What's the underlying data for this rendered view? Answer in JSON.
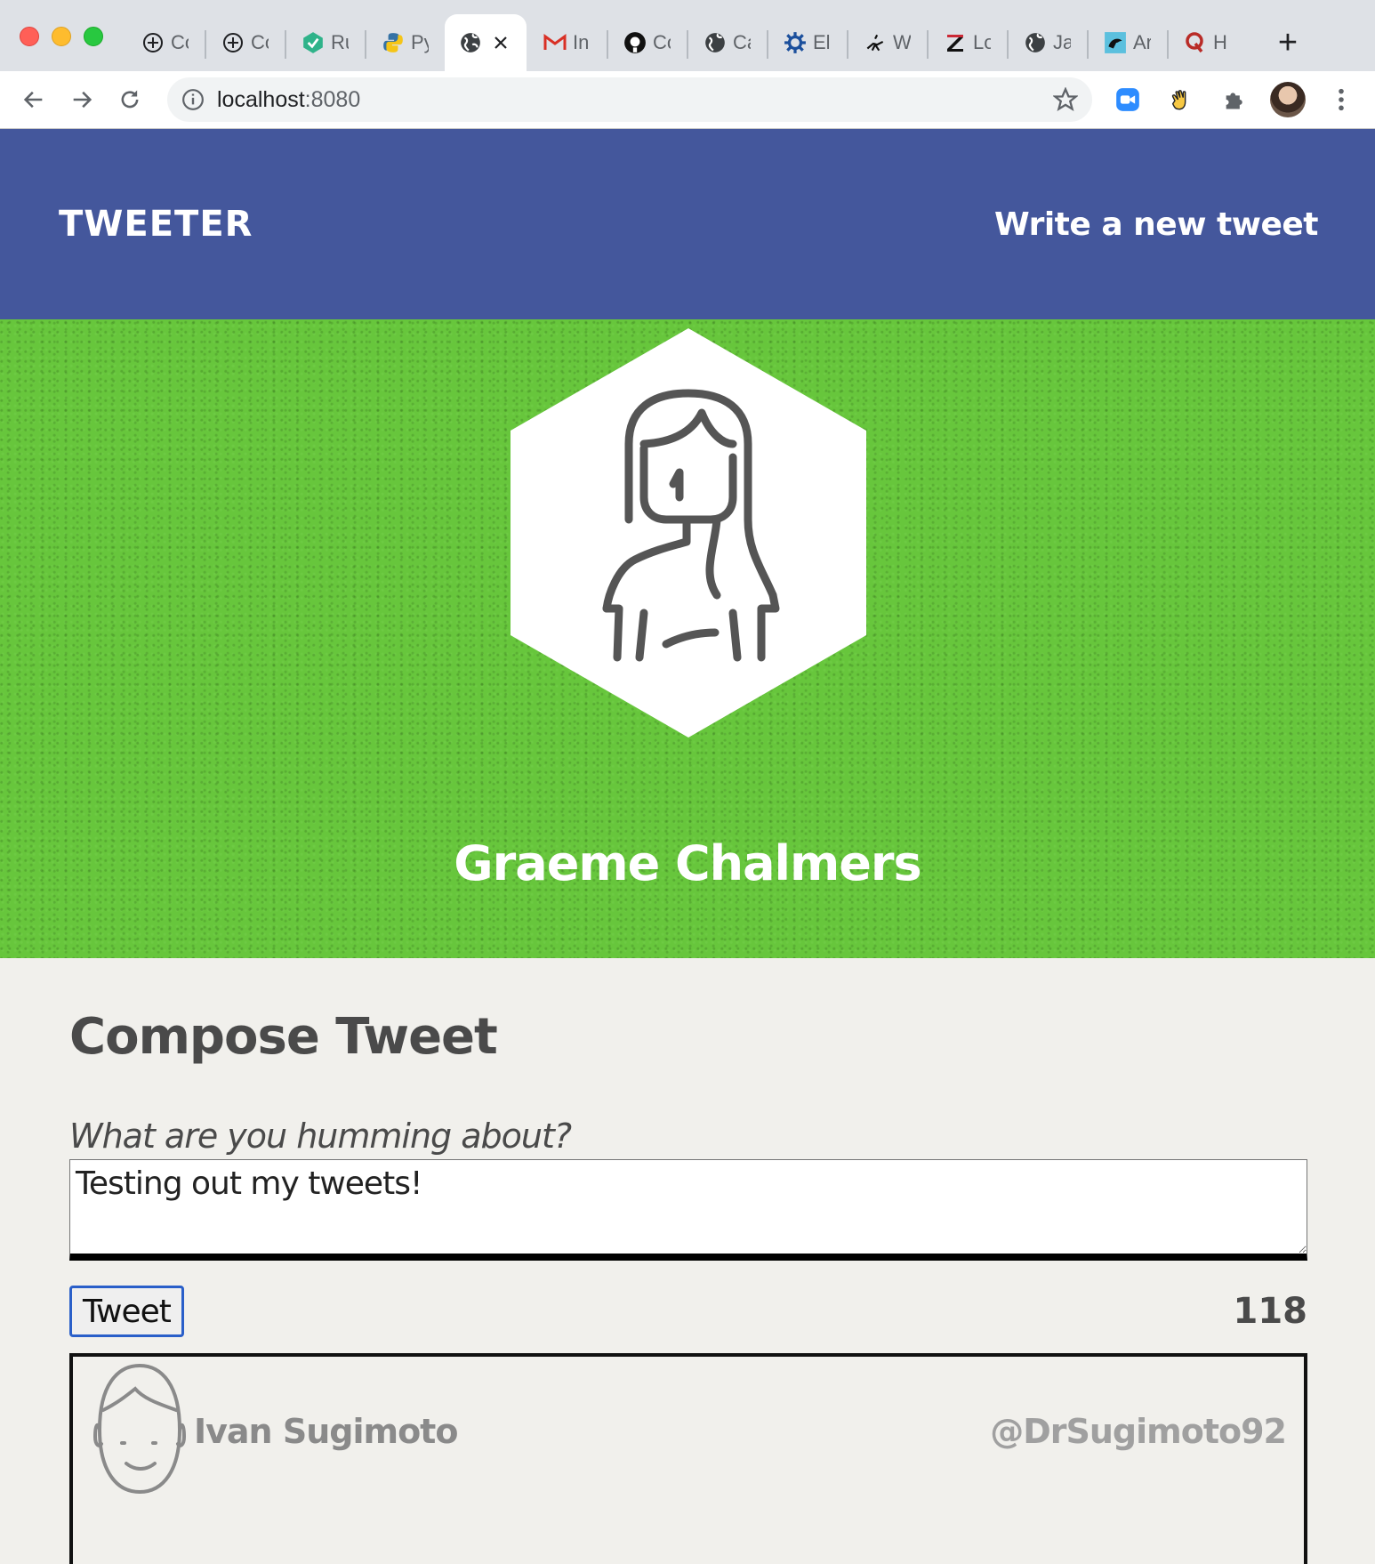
{
  "browser": {
    "tabs": [
      {
        "icon": "compass-icon",
        "label": "Co"
      },
      {
        "icon": "compass-icon",
        "label": "Co"
      },
      {
        "icon": "runner-shield-icon",
        "label": "Ru"
      },
      {
        "icon": "python-icon",
        "label": "Py"
      },
      {
        "icon": "globe-icon",
        "label": "",
        "active": true
      },
      {
        "icon": "gmail-icon",
        "label": "In"
      },
      {
        "icon": "github-icon",
        "label": "Co"
      },
      {
        "icon": "globe-icon",
        "label": "Ca"
      },
      {
        "icon": "gear-icon",
        "label": "El"
      },
      {
        "icon": "rider-icon",
        "label": "W"
      },
      {
        "icon": "zotero-icon",
        "label": "Lo"
      },
      {
        "icon": "globe-icon",
        "label": "Ja"
      },
      {
        "icon": "parrot-icon",
        "label": "Ar"
      },
      {
        "icon": "quora-icon",
        "label": "H"
      }
    ],
    "url_host": "localhost",
    "url_port": ":8080"
  },
  "nav": {
    "brand": "TWEETER",
    "write_link": "Write a new tweet"
  },
  "profile": {
    "name": "Graeme Chalmers"
  },
  "compose": {
    "title": "Compose Tweet",
    "prompt": "What are you humming about?",
    "text": "Testing out my tweets!",
    "button": "Tweet",
    "counter": "118"
  },
  "tweets": [
    {
      "author": "Ivan Sugimoto",
      "handle": "@DrSugimoto92"
    }
  ],
  "colors": {
    "nav_bg": "#44579c",
    "hero_bg": "#67c63c",
    "page_bg": "#f1f0ec",
    "button_border": "#2a5fc9"
  }
}
